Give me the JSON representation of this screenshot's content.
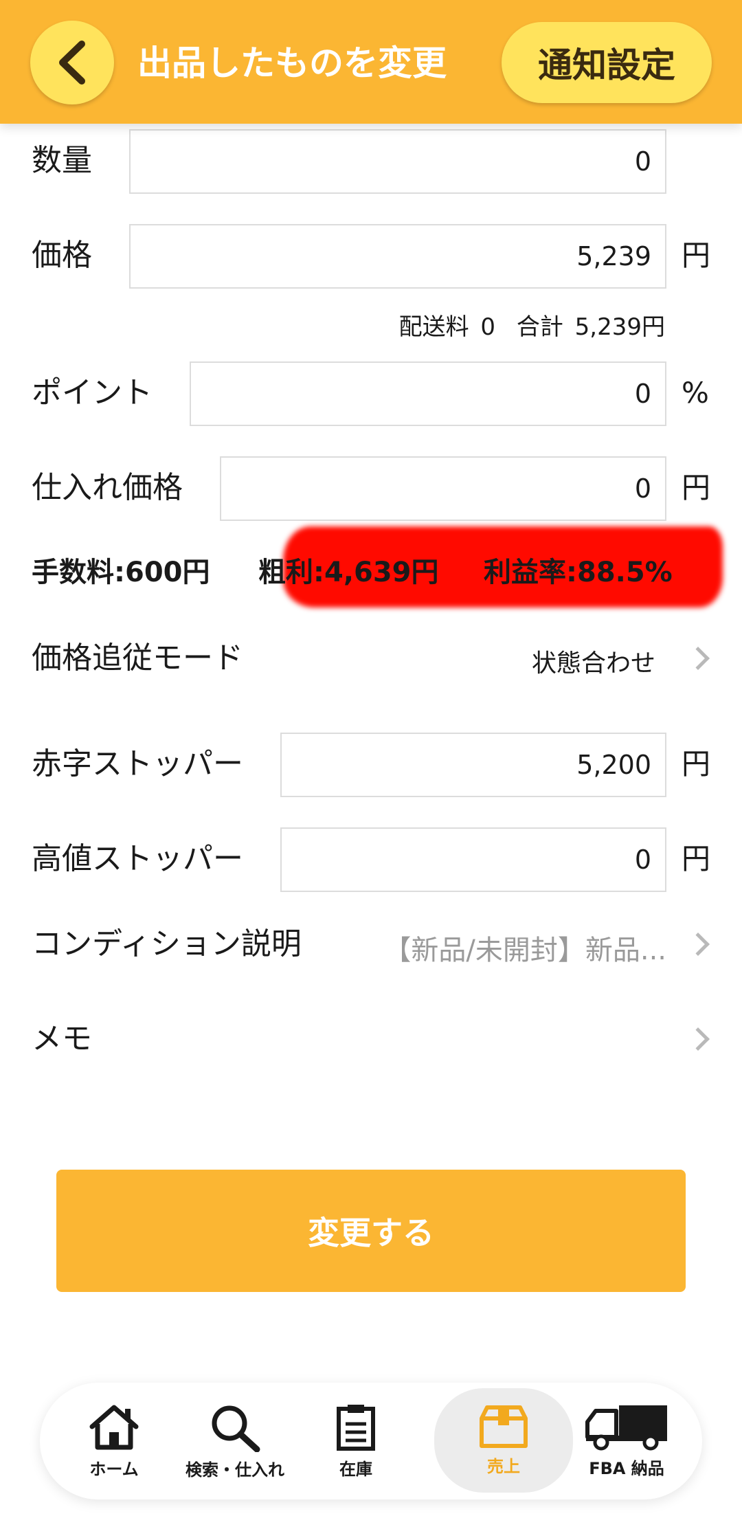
{
  "header": {
    "title": "出品したものを変更",
    "notify_button": "通知設定"
  },
  "form": {
    "quantity": {
      "label": "数量",
      "value": "0"
    },
    "price": {
      "label": "価格",
      "value": "5,239",
      "unit": "円"
    },
    "shipping": {
      "shipping_label": "配送料",
      "shipping_value": "0",
      "total_label": "合計",
      "total_value": "5,239円"
    },
    "point": {
      "label": "ポイント",
      "value": "0",
      "unit": "%"
    },
    "purchase_price": {
      "label": "仕入れ価格",
      "value": "0",
      "unit": "円"
    },
    "fee_text": "手数料:600円",
    "gross_profit_text": "粗利:4,639円",
    "profit_rate_text": "利益率:88.5%",
    "price_follow": {
      "label": "価格追従モード",
      "value": "状態合わせ"
    },
    "loss_stopper": {
      "label": "赤字ストッパー",
      "value": "5,200",
      "unit": "円"
    },
    "high_stopper": {
      "label": "高値ストッパー",
      "value": "0",
      "unit": "円"
    },
    "condition": {
      "label": "コンディション説明",
      "value": "【新品/未開封】新品..."
    },
    "memo": {
      "label": "メモ"
    }
  },
  "submit_label": "変更する",
  "tabs": [
    {
      "label": "ホーム",
      "icon": "home-icon"
    },
    {
      "label": "検索・仕入れ",
      "icon": "search-icon"
    },
    {
      "label": "在庫",
      "icon": "clipboard-icon"
    },
    {
      "label": "売上",
      "icon": "box-icon",
      "active": true
    },
    {
      "label": "FBA 納品",
      "icon": "truck-icon"
    }
  ],
  "colors": {
    "header": "#fbb633",
    "button_accent": "#ffe35c",
    "active_tab_text": "#f2a91e",
    "highlight": "#ff0a00"
  }
}
